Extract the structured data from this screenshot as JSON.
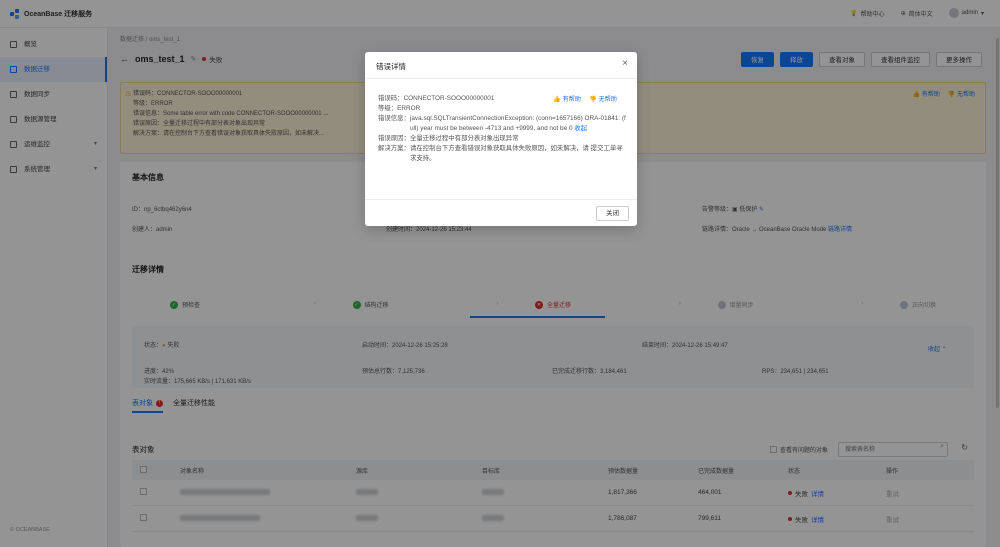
{
  "app": {
    "brand": "OceanBase 迁移服务"
  },
  "topbar": {
    "help": "帮助中心",
    "language": "简体中文",
    "user": "admin"
  },
  "sidebar": {
    "items": [
      {
        "label": "概览"
      },
      {
        "label": "数据迁移"
      },
      {
        "label": "数据同步"
      },
      {
        "label": "数据源管理"
      },
      {
        "label": "运维监控"
      },
      {
        "label": "系统管理"
      }
    ],
    "footer": "© OCEANBASE"
  },
  "page": {
    "breadcrumb": "数据迁移 / oms_test_1",
    "title": "oms_test_1",
    "status": "失败",
    "buttons": [
      "恢复",
      "释放",
      "查看对象",
      "查看组件监控",
      "更多操作"
    ]
  },
  "alert": {
    "lines": [
      "错误码：CONNECTOR-SOOO00000001",
      "等级：ERROR",
      "错误信息：Some table error with code CONNECTOR-SOOO00000001 ...",
      "错误原因：全量迁移过程中有部分表对象出现异常",
      "解决方案：请在控制台下方查看错误对象获取具体失败原因，如未解决..."
    ],
    "helpful": "有帮助",
    "unhelpful": "无帮助"
  },
  "basic_info": {
    "title": "基本信息",
    "id": "ID：np_6ctbq462y6n4",
    "creator": "创建人：admin",
    "created_at": "创建时间：2024-12-26 15:23:44",
    "alert_level_label": "告警等级：",
    "alert_level_value": "低保护",
    "link_detail_label": "链路详情：Oracle → OceanBase Oracle Mode",
    "link_detail_action": "链路详情"
  },
  "migration": {
    "title": "迁移详情",
    "steps": [
      {
        "label": "预检查",
        "state": "ok"
      },
      {
        "label": "结构迁移",
        "state": "ok"
      },
      {
        "label": "全量迁移",
        "state": "err"
      },
      {
        "label": "增量同步",
        "state": "wait"
      },
      {
        "label": "正向切换",
        "state": "wait"
      }
    ],
    "status_label": "状态：",
    "status_value": "失败",
    "start_time": "启动时间：2024-12-26 15:25:28",
    "end_time": "结束时间：2024-12-26 15:49:47",
    "collapse": "收起",
    "progress": "进度：42%",
    "realtime_traffic": "实时流量：175,665 KB/s | 171,631 KB/s",
    "estimated_rows": "预估总行数：7,125,736",
    "migrated_rows": "已完成迁移行数：3,184,461",
    "rps": "RPS：234,651 | 234,651"
  },
  "tabs": {
    "active": "表对象",
    "active_badge": "!",
    "other": "全量迁移性能"
  },
  "table_section": {
    "title": "表对象",
    "only_errors": "查看有问题的对象",
    "search_placeholder": "搜索表名称",
    "columns": [
      "对象名称",
      "源库",
      "目标库",
      "预估数据量",
      "已完成数据量",
      "状态",
      "操作"
    ],
    "rows": [
      {
        "estimated": "1,817,366",
        "done": "464,001",
        "status": "失败",
        "detail": "详情",
        "action": "重试"
      },
      {
        "estimated": "1,786,087",
        "done": "799,611",
        "status": "失败",
        "detail": "详情",
        "action": "重试"
      }
    ]
  },
  "modal": {
    "title": "错误详情",
    "code_label": "错误码：",
    "code_value": "CONNECTOR-SOOO00000001",
    "level_label": "等级：",
    "level_value": "ERROR",
    "info_label": "错误信息：",
    "info_value": "java.sql.SQLTransientConnectionException: (conn=1657166) ORA-01841: (full) year must be between -4713 and +9999, and not be 0",
    "info_more": "收起",
    "reason_label": "错误原因：",
    "reason_value": "全量迁移过程中有部分表对象出现异常",
    "solution_label": "解决方案：",
    "solution_value": "请在控制台下方查看错误对象获取具体失败原因，如未解决，请 提交工单寻求支持。",
    "helpful": "有帮助",
    "unhelpful": "无帮助",
    "close_button": "关闭"
  },
  "colors": {
    "primary": "#1677ff",
    "error": "#e03131",
    "success": "#2fb344",
    "warning_bg": "#fdf3da"
  }
}
